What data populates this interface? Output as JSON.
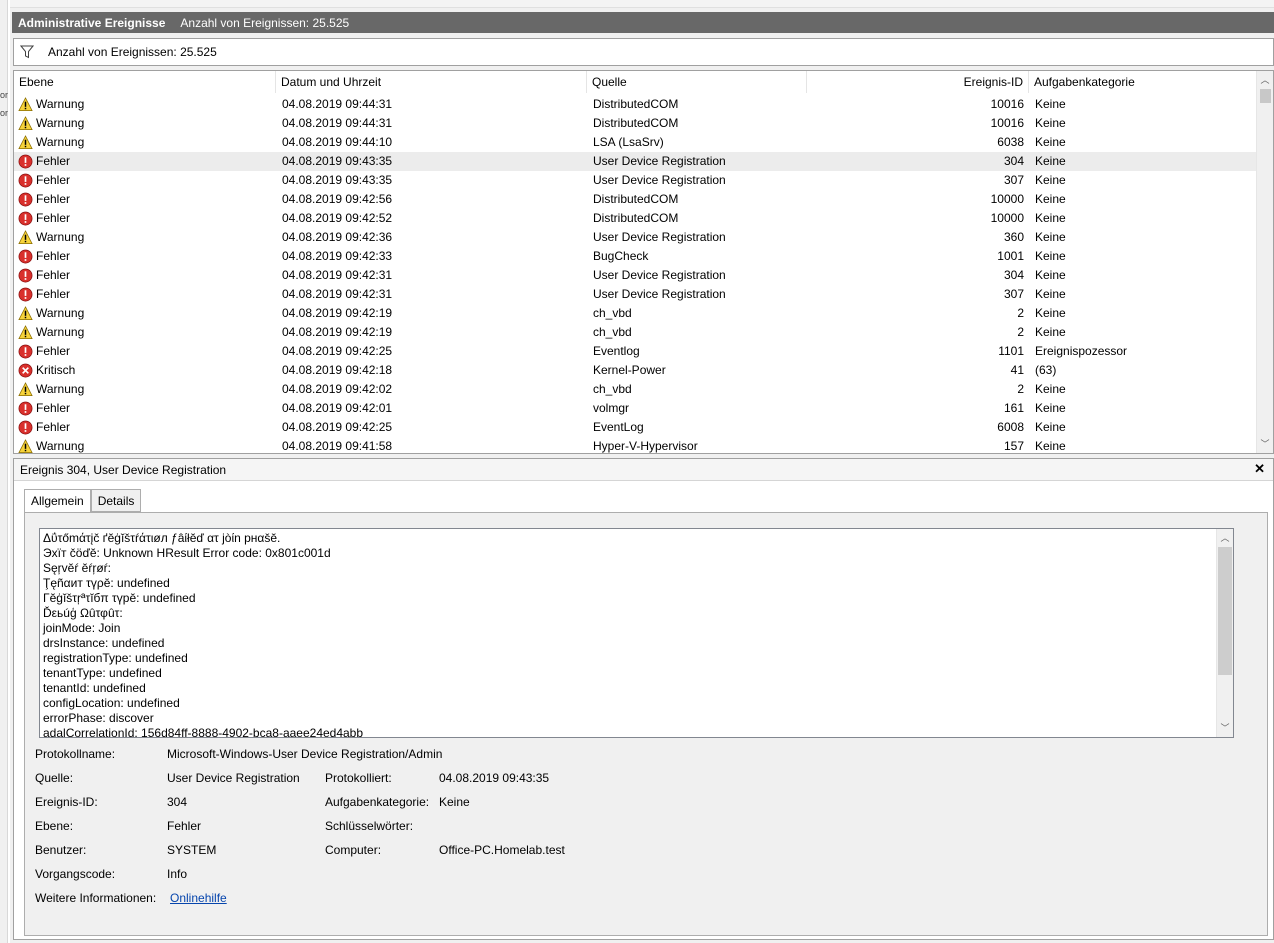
{
  "left_strip": {
    "frag1": "or",
    "frag2": "or"
  },
  "title": {
    "name": "Administrative Ereignisse",
    "count": "Anzahl von Ereignissen: 25.525"
  },
  "filter": {
    "label": "Anzahl von Ereignissen: 25.525"
  },
  "table": {
    "headers": {
      "level": "Ebene",
      "date": "Datum und Uhrzeit",
      "source": "Quelle",
      "event_id": "Ereignis-ID",
      "category": "Aufgabenkategorie"
    },
    "rows": [
      {
        "level": "Warnung",
        "icon": "warning-icon",
        "date": "04.08.2019 09:44:31",
        "source": "DistributedCOM",
        "id": "10016",
        "category": "Keine"
      },
      {
        "level": "Warnung",
        "icon": "warning-icon",
        "date": "04.08.2019 09:44:31",
        "source": "DistributedCOM",
        "id": "10016",
        "category": "Keine"
      },
      {
        "level": "Warnung",
        "icon": "warning-icon",
        "date": "04.08.2019 09:44:10",
        "source": "LSA (LsaSrv)",
        "id": "6038",
        "category": "Keine"
      },
      {
        "level": "Fehler",
        "icon": "error-icon",
        "date": "04.08.2019 09:43:35",
        "source": "User Device Registration",
        "id": "304",
        "category": "Keine",
        "selected": true
      },
      {
        "level": "Fehler",
        "icon": "error-icon",
        "date": "04.08.2019 09:43:35",
        "source": "User Device Registration",
        "id": "307",
        "category": "Keine"
      },
      {
        "level": "Fehler",
        "icon": "error-icon",
        "date": "04.08.2019 09:42:56",
        "source": "DistributedCOM",
        "id": "10000",
        "category": "Keine"
      },
      {
        "level": "Fehler",
        "icon": "error-icon",
        "date": "04.08.2019 09:42:52",
        "source": "DistributedCOM",
        "id": "10000",
        "category": "Keine"
      },
      {
        "level": "Warnung",
        "icon": "warning-icon",
        "date": "04.08.2019 09:42:36",
        "source": "User Device Registration",
        "id": "360",
        "category": "Keine"
      },
      {
        "level": "Fehler",
        "icon": "error-icon",
        "date": "04.08.2019 09:42:33",
        "source": "BugCheck",
        "id": "1001",
        "category": "Keine"
      },
      {
        "level": "Fehler",
        "icon": "error-icon",
        "date": "04.08.2019 09:42:31",
        "source": "User Device Registration",
        "id": "304",
        "category": "Keine"
      },
      {
        "level": "Fehler",
        "icon": "error-icon",
        "date": "04.08.2019 09:42:31",
        "source": "User Device Registration",
        "id": "307",
        "category": "Keine"
      },
      {
        "level": "Warnung",
        "icon": "warning-icon",
        "date": "04.08.2019 09:42:19",
        "source": "ch_vbd",
        "id": "2",
        "category": "Keine"
      },
      {
        "level": "Warnung",
        "icon": "warning-icon",
        "date": "04.08.2019 09:42:19",
        "source": "ch_vbd",
        "id": "2",
        "category": "Keine"
      },
      {
        "level": "Fehler",
        "icon": "error-icon",
        "date": "04.08.2019 09:42:25",
        "source": "Eventlog",
        "id": "1101",
        "category": "Ereignispozessor"
      },
      {
        "level": "Kritisch",
        "icon": "critical-icon",
        "date": "04.08.2019 09:42:18",
        "source": "Kernel-Power",
        "id": "41",
        "category": "(63)"
      },
      {
        "level": "Warnung",
        "icon": "warning-icon",
        "date": "04.08.2019 09:42:02",
        "source": "ch_vbd",
        "id": "2",
        "category": "Keine"
      },
      {
        "level": "Fehler",
        "icon": "error-icon",
        "date": "04.08.2019 09:42:01",
        "source": "volmgr",
        "id": "161",
        "category": "Keine"
      },
      {
        "level": "Fehler",
        "icon": "error-icon",
        "date": "04.08.2019 09:42:25",
        "source": "EventLog",
        "id": "6008",
        "category": "Keine"
      },
      {
        "level": "Warnung",
        "icon": "warning-icon",
        "date": "04.08.2019 09:41:58",
        "source": "Hyper-V-Hypervisor",
        "id": "157",
        "category": "Keine"
      }
    ]
  },
  "detail": {
    "header": "Ereignis 304, User Device Registration",
    "close": "✕",
    "tabs": {
      "general": "Allgemein",
      "details": "Details"
    },
    "message_lines": [
      "Δΰτőmάτįč ґĕġĭšτŕάτιøл ƒâίłĕď ατ jòίn рнαšĕ.",
      "Эхїт čöďĕ: Unknown HResult Error code: 0x801c001d",
      "Sęŗvĕŕ ĕŕŗøŕ:",
      "Ţęñαит τүρĕ: undefined",
      "Γĕġĭšτŗªτĭбπ τүрĕ: undefined",
      "Ďεьúģ Ωûτφûτ:",
      "joinMode: Join",
      "drsInstance: undefined",
      "registrationType: undefined",
      "tenantType: undefined",
      "tenantId: undefined",
      "configLocation: undefined",
      "errorPhase: discover",
      "adalCorrelationId: 156d84ff-8888-4902-bca8-aaee24ed4abb"
    ],
    "props": {
      "log_name_label": "Protokollname:",
      "log_name": "Microsoft-Windows-User Device Registration/Admin",
      "source_label": "Quelle:",
      "source": "User Device Registration",
      "logged_label": "Protokolliert:",
      "logged": "04.08.2019 09:43:35",
      "event_id_label": "Ereignis-ID:",
      "event_id": "304",
      "task_label": "Aufgabenkategorie:",
      "task": "Keine",
      "level_label": "Ebene:",
      "level": "Fehler",
      "keywords_label": "Schlüsselwörter:",
      "user_label": "Benutzer:",
      "user": "SYSTEM",
      "computer_label": "Computer:",
      "computer": "Office-PC.Homelab.test",
      "opcode_label": "Vorgangscode:",
      "opcode": "Info",
      "more_info_label": "Weitere Informationen:",
      "more_info_link": "Onlinehilfe"
    }
  }
}
